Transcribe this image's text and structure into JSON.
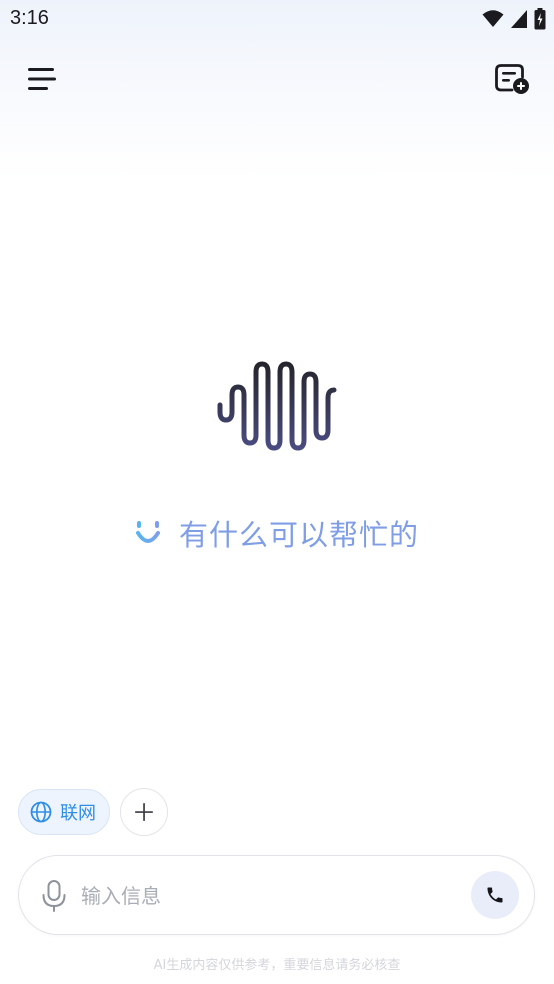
{
  "status_bar": {
    "time": "3:16",
    "icons": [
      "wifi-icon",
      "cellular-signal-icon",
      "battery-charging-icon"
    ]
  },
  "header": {
    "menu_icon": "hamburger-menu-icon",
    "new_chat_icon": "new-chat-icon"
  },
  "main": {
    "logo_icon": "sound-wave-logo-icon",
    "greeting_icon": "smile-icon",
    "greeting": "有什么可以帮忙的"
  },
  "chips": {
    "web_search_label": "联网",
    "web_search_icon": "globe-icon",
    "more_icon": "plus-icon"
  },
  "composer": {
    "placeholder": "输入信息",
    "mic_icon": "microphone-icon",
    "call_icon": "phone-icon"
  },
  "footer": {
    "disclaimer": "AI生成内容仅供参考，重要信息请务必核查"
  },
  "colors": {
    "accent_blue": "#2f8de6",
    "greeting_text": "#7f9ee6",
    "logo_dark": "#25252d",
    "logo_indigo": "#4a4c80"
  }
}
